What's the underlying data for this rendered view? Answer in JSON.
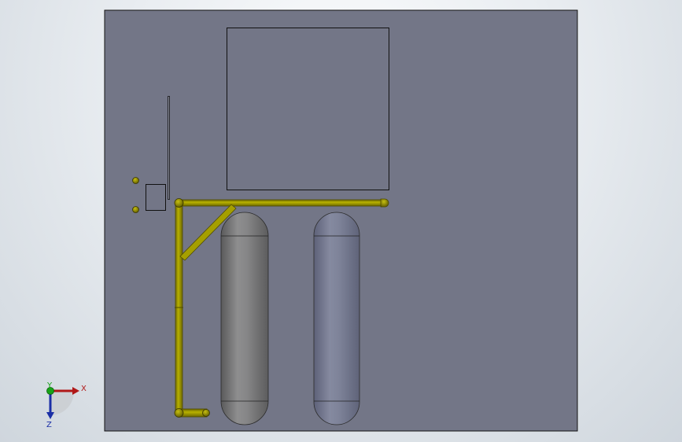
{
  "viewport": {
    "colors": {
      "background_top": "#fbfcfd",
      "background_bottom": "#cfd6dd",
      "panel_fill": "#737687",
      "outline": "#111111",
      "pipe": "#a6a000",
      "pipe_dark": "#5f5a00",
      "tank1": "#7f7f80",
      "tank2": "#787d94"
    }
  },
  "parts": {
    "base_plate": "plate",
    "upper_box": "box",
    "left_rail": "rail",
    "small_box": "small-box",
    "fasteners": 2,
    "tanks": 2,
    "pipes": "yellow-pipe-assembly"
  },
  "triad": {
    "x_label": "X",
    "y_label": "Y",
    "z_label": "Z",
    "x_color": "#b01818",
    "y_color": "#17a317",
    "z_color": "#1b2fa6"
  }
}
